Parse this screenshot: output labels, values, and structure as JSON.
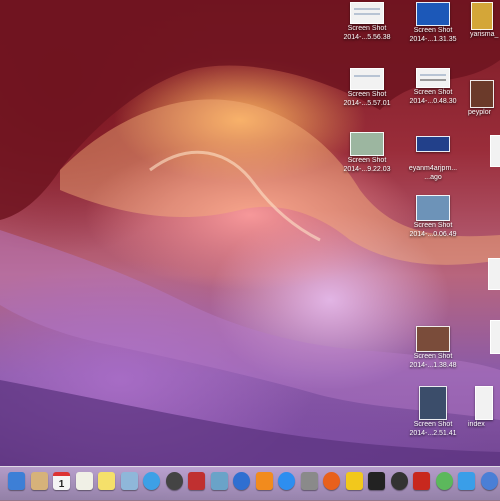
{
  "desktop_icons": [
    {
      "line1": "Screen Shot",
      "line2": "2014-...5.56.38"
    },
    {
      "line1": "Screen Shot",
      "line2": "2014-...1.31.35"
    },
    {
      "line1": "yarisma_",
      "line2": ""
    },
    {
      "line1": "Screen Shot",
      "line2": "2014-...5.57.01"
    },
    {
      "line1": "Screen Shot",
      "line2": "2014-...0.48.30"
    },
    {
      "line1": "peyplor",
      "line2": ""
    },
    {
      "line1": "Screen Shot",
      "line2": "2014-...9.22.03"
    },
    {
      "line1": "eyanm4arjpm...",
      "line2": "...ago"
    },
    {
      "line1": "Screen Shot",
      "line2": "2014-...0.06.49"
    },
    {
      "line1": "Screen Shot",
      "line2": "2014-...1.38.48"
    },
    {
      "line1": "Screen Shot",
      "line2": "2014-...2.51.41"
    },
    {
      "line1": "index",
      "line2": ""
    }
  ],
  "dock": {
    "items": [
      {
        "name": "finder-icon",
        "color": "#3d7fd6"
      },
      {
        "name": "notes-icon",
        "color": "#d6b27a"
      },
      {
        "name": "calendar-icon",
        "color": "#f4f4f4"
      },
      {
        "name": "textedit-icon",
        "color": "#f0f0e6"
      },
      {
        "name": "stickies-icon",
        "color": "#f5e06a"
      },
      {
        "name": "preview-icon",
        "color": "#8fb7d9"
      },
      {
        "name": "safari-icon",
        "color": "#3da0e6"
      },
      {
        "name": "photobooth-icon",
        "color": "#444444"
      },
      {
        "name": "photo-icon",
        "color": "#c03030"
      },
      {
        "name": "iphoto-icon",
        "color": "#6aa3c8"
      },
      {
        "name": "itunes-icon",
        "color": "#2f6fd1"
      },
      {
        "name": "ibooks-icon",
        "color": "#f28b1d"
      },
      {
        "name": "appstore-icon",
        "color": "#2d8ef0"
      },
      {
        "name": "systemprefs-icon",
        "color": "#8a8a8a"
      },
      {
        "name": "firefox-icon",
        "color": "#e8601c"
      },
      {
        "name": "cyberduck-icon",
        "color": "#f2c81c"
      },
      {
        "name": "terminal-icon",
        "color": "#222222"
      },
      {
        "name": "dvd-icon",
        "color": "#333333"
      },
      {
        "name": "filezilla-icon",
        "color": "#c8281e"
      },
      {
        "name": "vlc-icon",
        "color": "#5cb85c"
      },
      {
        "name": "twitter-icon",
        "color": "#3a9ee8"
      },
      {
        "name": "spotlight-icon",
        "color": "#4a7fd6"
      }
    ],
    "calendar_day": "1"
  }
}
